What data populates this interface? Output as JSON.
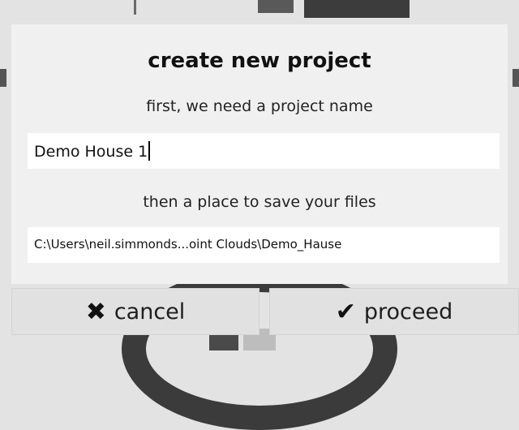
{
  "dialog": {
    "title": "create new project",
    "name_prompt": "first, we need a project name",
    "name_value": "Demo House 1",
    "location_prompt": "then a place to save your files",
    "location_value": "C:\\Users\\neil.simmonds...oint Clouds\\Demo_Hause"
  },
  "buttons": {
    "cancel_label": "cancel",
    "cancel_icon": "close-x-icon",
    "proceed_label": "proceed",
    "proceed_icon": "checkmark-icon"
  }
}
